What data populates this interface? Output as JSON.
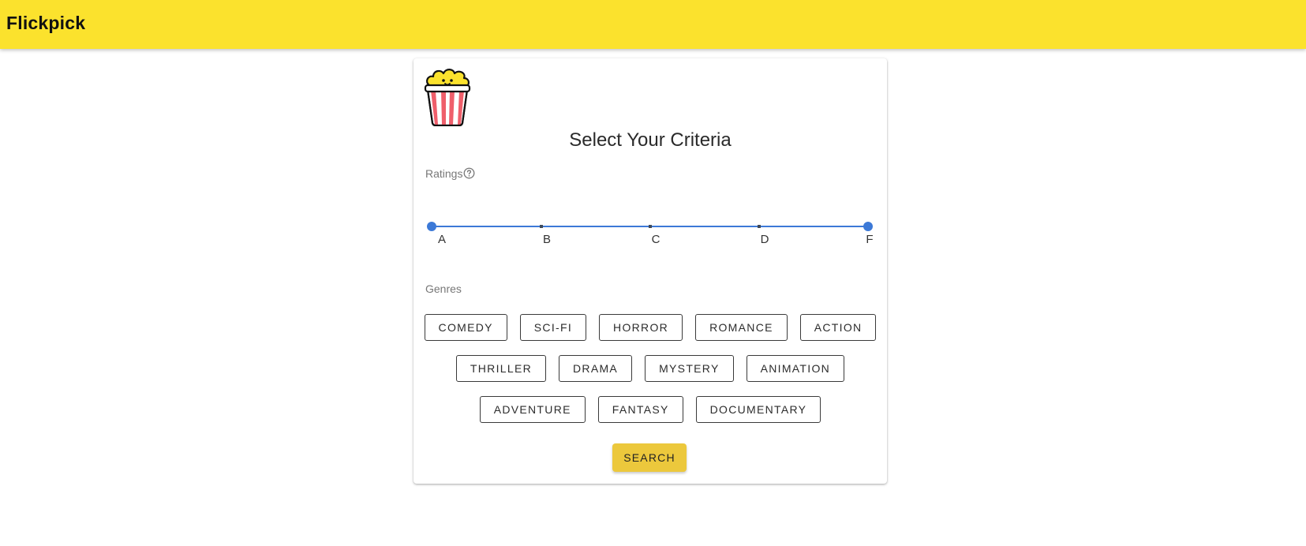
{
  "app": {
    "title": "Flickpick"
  },
  "card": {
    "logo_icon": "popcorn-icon",
    "title": "Select Your Criteria",
    "ratings": {
      "label": "Ratings",
      "help_icon": "help-circle-icon",
      "marks": [
        "A",
        "B",
        "C",
        "D",
        "F"
      ],
      "selected_range": [
        "A",
        "F"
      ]
    },
    "genres": {
      "label": "Genres",
      "rows": [
        [
          "COMEDY",
          "SCI-FI",
          "HORROR",
          "ROMANCE",
          "ACTION"
        ],
        [
          "THRILLER",
          "DRAMA",
          "MYSTERY",
          "ANIMATION"
        ],
        [
          "ADVENTURE",
          "FANTASY",
          "DOCUMENTARY"
        ]
      ]
    },
    "search_label": "SEARCH"
  },
  "colors": {
    "appbar": "#fbe22d",
    "slider": "#3c79d7",
    "search_button": "#ecc83c"
  }
}
